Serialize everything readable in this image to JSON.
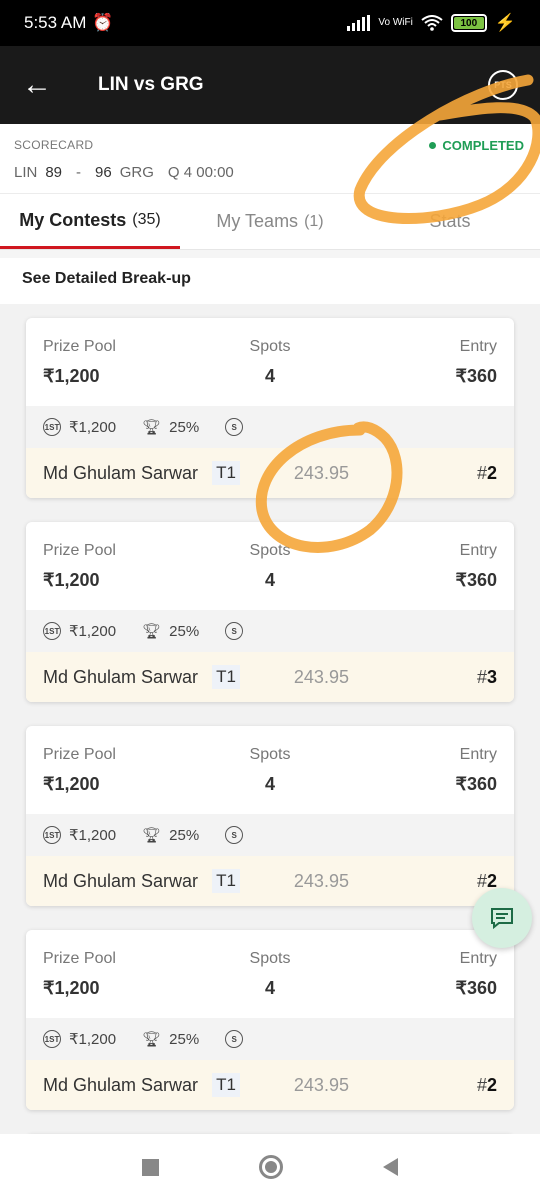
{
  "status_bar": {
    "time": "5:53 AM",
    "network": "Vo WiFi",
    "battery": "100"
  },
  "header": {
    "title": "LIN vs GRG",
    "back_icon": "arrow-left-icon",
    "pts_label": "PTS"
  },
  "scorecard": {
    "label": "SCORECARD",
    "team1": "LIN",
    "score1": "89",
    "separator": "-",
    "score2": "96",
    "team2": "GRG",
    "period": "Q 4 00:00",
    "status": "COMPLETED",
    "status_color": "#1f9d55"
  },
  "tabs": [
    {
      "label": "My Contests",
      "count": "(35)"
    },
    {
      "label": "My Teams",
      "count": "(1)"
    },
    {
      "label": "Stats",
      "count": ""
    }
  ],
  "breakup_link": "See Detailed Break-up",
  "contests": [
    {
      "prize_label": "Prize Pool",
      "prize": "₹1,200",
      "spots_label": "Spots",
      "spots": "4",
      "entry_label": "Entry",
      "entry": "₹360",
      "first_prize": "₹1,200",
      "win_pct": "25%",
      "single_badge": "S",
      "user": "Md Ghulam Sarwar",
      "team": "T1",
      "points": "243.95",
      "rank_hash": "#",
      "rank": "2"
    },
    {
      "prize_label": "Prize Pool",
      "prize": "₹1,200",
      "spots_label": "Spots",
      "spots": "4",
      "entry_label": "Entry",
      "entry": "₹360",
      "first_prize": "₹1,200",
      "win_pct": "25%",
      "single_badge": "S",
      "user": "Md Ghulam Sarwar",
      "team": "T1",
      "points": "243.95",
      "rank_hash": "#",
      "rank": "3"
    },
    {
      "prize_label": "Prize Pool",
      "prize": "₹1,200",
      "spots_label": "Spots",
      "spots": "4",
      "entry_label": "Entry",
      "entry": "₹360",
      "first_prize": "₹1,200",
      "win_pct": "25%",
      "single_badge": "S",
      "user": "Md Ghulam Sarwar",
      "team": "T1",
      "points": "243.95",
      "rank_hash": "#",
      "rank": "2"
    },
    {
      "prize_label": "Prize Pool",
      "prize": "₹1,200",
      "spots_label": "Spots",
      "spots": "4",
      "entry_label": "Entry",
      "entry": "₹360",
      "first_prize": "₹1,200",
      "win_pct": "25%",
      "single_badge": "S",
      "user": "Md Ghulam Sarwar",
      "team": "T1",
      "points": "243.95",
      "rank_hash": "#",
      "rank": "2"
    }
  ],
  "first_badge": "1ST",
  "accent_color": "#d0171f",
  "annotation_color": "#f5a63a"
}
